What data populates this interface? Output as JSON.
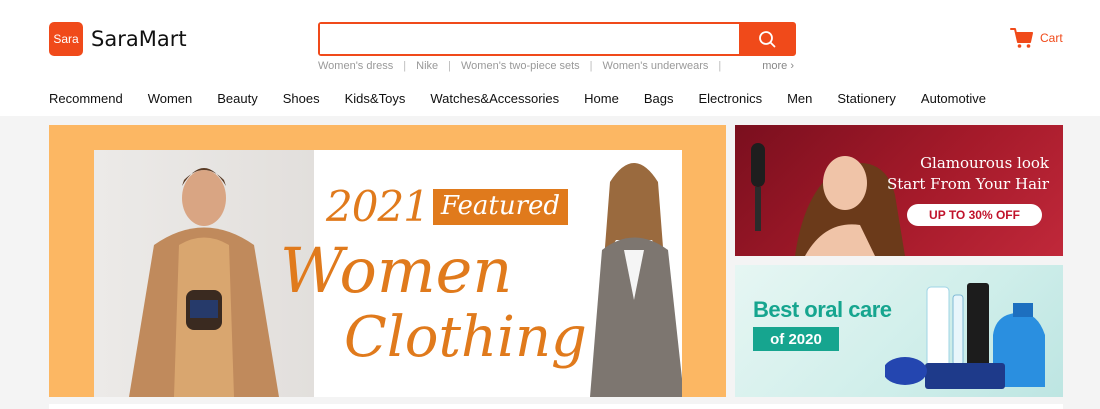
{
  "brand": {
    "logo_badge": "Sara",
    "name": "SaraMart",
    "accent": "#f04a1a"
  },
  "search": {
    "value": "",
    "placeholder": "",
    "button_icon": "search-icon"
  },
  "hot_searches": {
    "items": [
      "Women's dress",
      "Nike",
      "Women's two-piece sets",
      "Women's underwears"
    ],
    "more_label": "more ›"
  },
  "cart": {
    "icon": "cart-icon",
    "label": "Cart"
  },
  "nav": {
    "items": [
      "Recommend",
      "Women",
      "Beauty",
      "Shoes",
      "Kids&Toys",
      "Watches&Accessories",
      "Home",
      "Bags",
      "Electronics",
      "Men",
      "Stationery",
      "Automotive"
    ]
  },
  "banners": {
    "main": {
      "year": "2021",
      "tag": "Featured",
      "line1": "Women",
      "line2": "Clothing"
    },
    "hair": {
      "line1": "Glamourous look",
      "line2": "Start From Your Hair",
      "offer": "UP TO 30% OFF"
    },
    "oral": {
      "title": "Best oral care",
      "tag": "of 2020"
    }
  }
}
